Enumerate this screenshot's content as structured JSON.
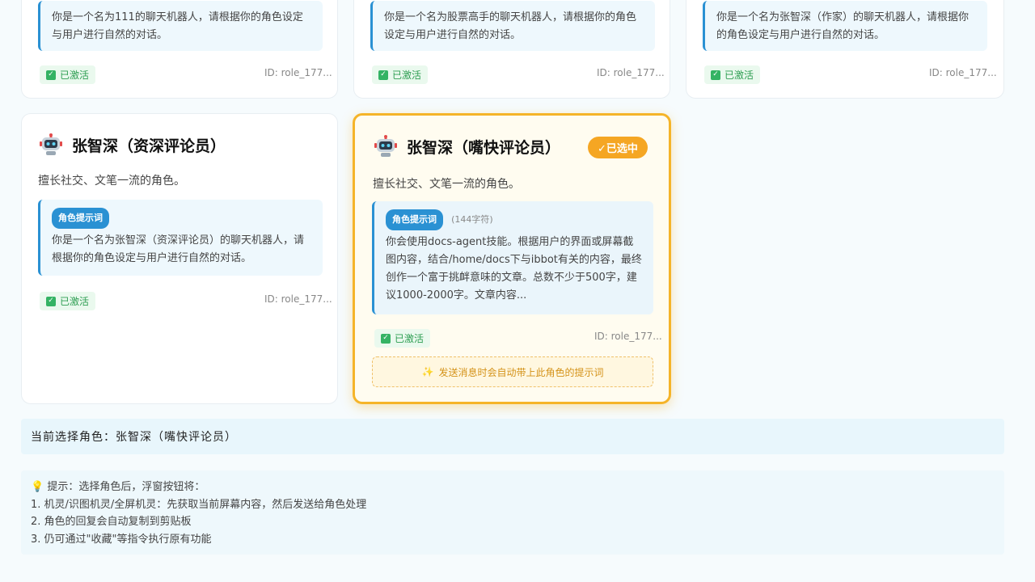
{
  "top_cards": [
    {
      "prompt": "你是一个名为111的聊天机器人，请根据你的角色设定与用户进行自然的对话。",
      "status": "已激活",
      "id": "ID: role_177..."
    },
    {
      "prompt": "你是一个名为股票高手的聊天机器人，请根据你的角色设定与用户进行自然的对话。",
      "status": "已激活",
      "id": "ID: role_177..."
    },
    {
      "prompt": "你是一个名为张智深（作家）的聊天机器人，请根据你的角色设定与用户进行自然的对话。",
      "status": "已激活",
      "id": "ID: role_177..."
    }
  ],
  "card_left": {
    "title": "张智深（资深评论员）",
    "desc": "擅长社交、文笔一流的角色。",
    "tag": "角色提示词",
    "prompt": "你是一个名为张智深（资深评论员）的聊天机器人，请根据你的角色设定与用户进行自然的对话。",
    "status": "已激活",
    "id": "ID: role_177..."
  },
  "card_selected": {
    "title": "张智深（嘴快评论员）",
    "badge": "✓已选中",
    "desc": "擅长社交、文笔一流的角色。",
    "tag": "角色提示词",
    "char_count": "(144字符)",
    "prompt": "你会使用docs-agent技能。根据用户的界面或屏幕截图内容，结合/home/docs下与ibbot有关的内容，最终创作一个富于挑衅意味的文章。总数不少于500字，建议1000-2000字。文章内容...",
    "status": "已激活",
    "id": "ID: role_177...",
    "auto_note": "发送消息时会自动带上此角色的提示词"
  },
  "current_selection": "当前选择角色：张智深（嘴快评论员）",
  "hints": {
    "title": "提示：选择角色后，浮窗按钮将：",
    "lines": [
      "1. 机灵/识图机灵/全屏机灵：先获取当前屏幕内容，然后发送给角色处理",
      "2. 角色的回复会自动复制到剪贴板",
      "3. 仍可通过\"收藏\"等指令执行原有功能"
    ]
  },
  "colors": {
    "accent": "#2a91d3",
    "selected_border": "#f5b429",
    "active_green": "#2e9e52"
  }
}
